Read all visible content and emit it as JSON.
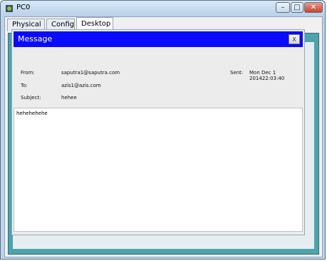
{
  "window": {
    "title": "PC0",
    "blurred_menu_items": [
      "",
      "",
      "",
      "",
      "",
      "",
      "",
      ""
    ],
    "buttons": {
      "minimize": "–",
      "maximize": "□",
      "close": "✕"
    }
  },
  "tabs": [
    {
      "label": "Physical"
    },
    {
      "label": "Config"
    },
    {
      "label": "Desktop",
      "active": true
    }
  ],
  "message": {
    "title": "Message",
    "close_label": "X",
    "from_label": "From:",
    "from_value": "saputra1@saputra.com",
    "to_label": "To:",
    "to_value": "azis1@azis.com",
    "subject_label": "Subject:",
    "subject_value": "hehee",
    "sent_label": "Sent:",
    "sent_value": "Mon Dec 1 201422:03:40",
    "body": "hehehehehe"
  },
  "colors": {
    "desktop_bg": "#4ea3ac",
    "message_titlebar": "#0a0aff"
  }
}
